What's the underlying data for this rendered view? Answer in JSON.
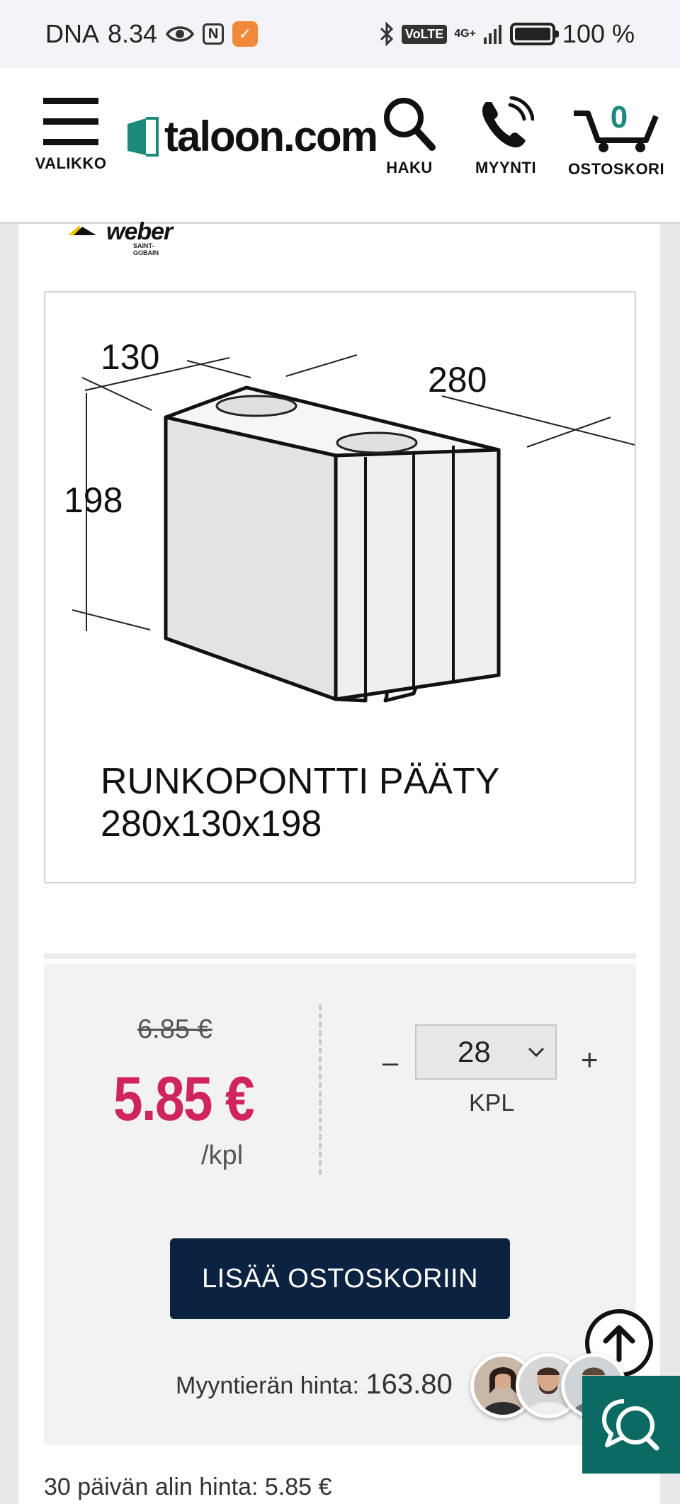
{
  "status_bar": {
    "carrier": "DNA",
    "time": "8.34",
    "volte": "VoLTE",
    "network": "4G+",
    "battery": "100 %",
    "battery_level": 1.0
  },
  "header": {
    "menu_label": "VALIKKO",
    "logo_text": "taloon.com",
    "search_label": "HAKU",
    "sales_label": "MYYNTI",
    "cart_label": "OSTOSKORI",
    "cart_count": "0"
  },
  "product": {
    "brand": "weber",
    "brand_sub": "SAINT-GOBAIN",
    "image": {
      "dim_depth": "130",
      "dim_length": "280",
      "dim_height": "198",
      "caption_line1": "RUNKOPONTTI PÄÄTY",
      "caption_line2": "280x130x198"
    }
  },
  "pricing": {
    "old_price": "6.85 €",
    "sale_price": "5.85 €",
    "unit": "/kpl",
    "quantity": "28",
    "quantity_unit": "KPL",
    "minus": "–",
    "plus": "+",
    "add_to_cart": "LISÄÄ OSTOSKORIIN",
    "lot_price_label": "Myyntierän hinta:",
    "lot_price_value": "163.80",
    "lowest_30_days": "30 päivän alin hinta: 5.85 €"
  },
  "colors": {
    "sale": "#d0245e",
    "primary_button": "#0b2340",
    "chat": "#0b6b63"
  }
}
